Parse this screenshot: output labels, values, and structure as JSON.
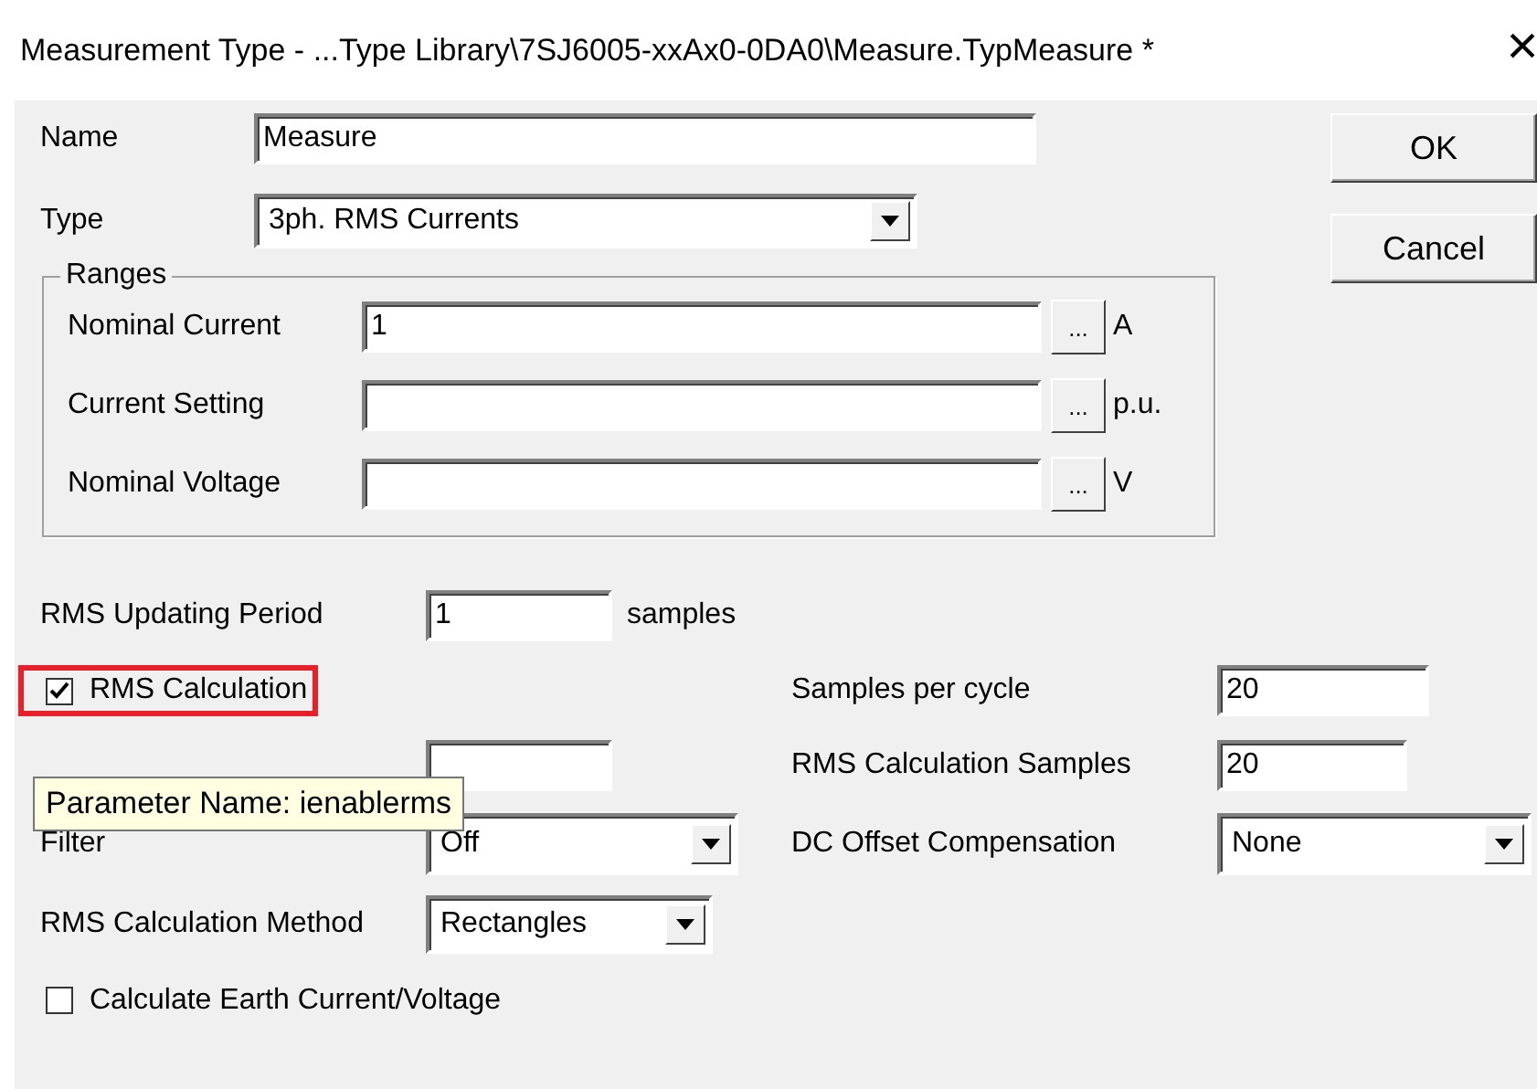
{
  "window": {
    "title": "Measurement Type - ...Type Library\\7SJ6005-xxAx0-0DA0\\Measure.TypMeasure *",
    "close": "×"
  },
  "name": {
    "label": "Name",
    "value": "Measure"
  },
  "type": {
    "label": "Type",
    "value": "3ph. RMS Currents"
  },
  "buttons": [
    {
      "label": "OK"
    },
    {
      "label": "Cancel"
    }
  ],
  "ranges": {
    "title": "Ranges",
    "rows": [
      {
        "label": "Nominal Current",
        "value": "1",
        "browse": "...",
        "unit": "A"
      },
      {
        "label": "Current Setting",
        "browse": "...",
        "unit": "p.u."
      },
      {
        "label": "Nominal Voltage",
        "browse": "...",
        "unit": "V"
      }
    ]
  },
  "rms_updating_period": {
    "label": "RMS Updating Period",
    "value": "1",
    "unit": "samples"
  },
  "rms_calculation": {
    "label": "RMS Calculation",
    "checked": true,
    "highlighted": true
  },
  "tooltip": {
    "text": "Parameter Name: ienablerms"
  },
  "samples_per_cycle": {
    "label": "Samples per cycle",
    "value": "20"
  },
  "rms_calculation_samples": {
    "label": "RMS Calculation Samples",
    "value": "20"
  },
  "filter": {
    "label": "Filter",
    "value": "Off"
  },
  "dc_offset_compensation": {
    "label": "DC Offset Compensation",
    "value": "None"
  },
  "rms_calculation_method": {
    "label": "RMS Calculation Method",
    "value": "Rectangles"
  },
  "calculate_earth": {
    "label": "Calculate Earth Current/Voltage",
    "checked": false,
    "highlighted": false
  }
}
